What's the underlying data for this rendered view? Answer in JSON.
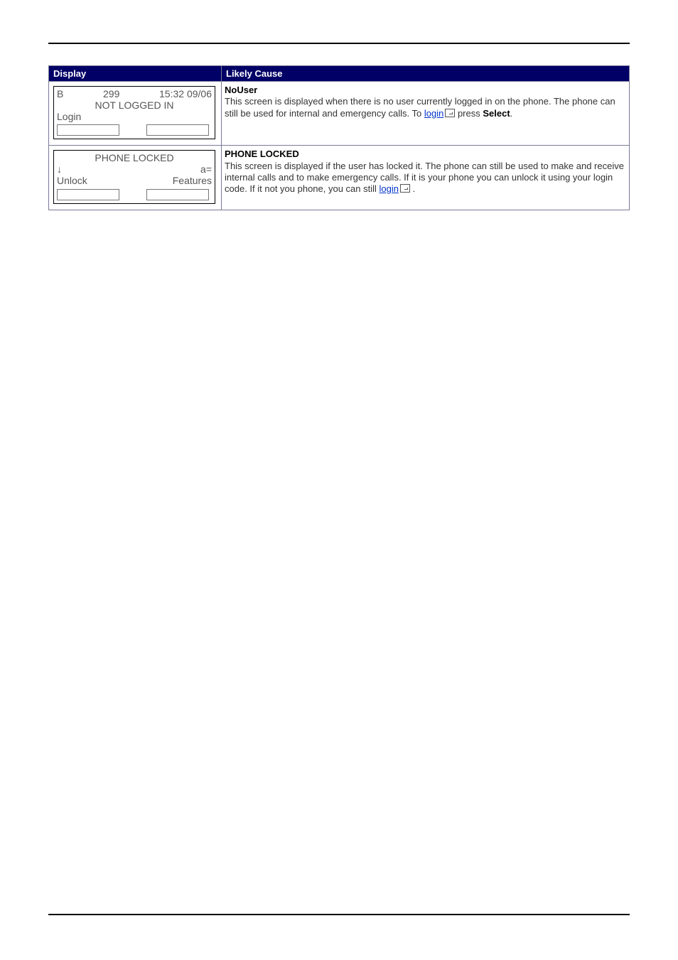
{
  "table": {
    "headers": {
      "display": "Display",
      "cause": "Likely Cause"
    },
    "rows": [
      {
        "lcd": {
          "line1_left": "B",
          "line1_center": "299",
          "line1_right": "15:32 09/06",
          "line2_center": "NOT LOGGED IN",
          "line3_left": "Login",
          "line3_right": ""
        },
        "cause": {
          "title": "NoUser",
          "text1": "This screen is displayed when there is no user currently logged in on the phone. The phone can still be used for internal and emergency calls. To ",
          "link": "login",
          "text2": " press ",
          "bold_end": "Select",
          "text3": "."
        }
      },
      {
        "lcd": {
          "line1_left": "",
          "line1_center": "PHONE LOCKED",
          "line1_right": "",
          "line2_left": "↓",
          "line2_right": "a=",
          "line3_left": "Unlock",
          "line3_right": "Features"
        },
        "cause": {
          "title": "PHONE LOCKED",
          "text1": "This screen is displayed if the user has locked it. The phone can still be used to make and receive internal calls and to make emergency calls. If it is your phone you can unlock it using your login code. If it not you phone, you can still ",
          "link": "login",
          "text2": " .",
          "bold_end": "",
          "text3": ""
        }
      }
    ]
  }
}
